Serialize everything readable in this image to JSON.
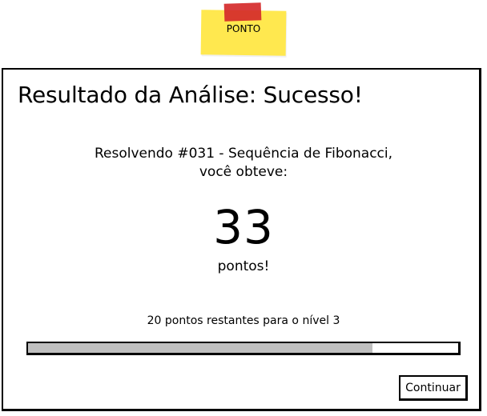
{
  "sticky_note": {
    "label": "PONTO",
    "color": "#ffe84f",
    "tape_color": "#d52a2a"
  },
  "dialog": {
    "title": "Resultado da Análise: Sucesso!",
    "description_line1": "Resolvendo #031 - Sequência de Fibonacci,",
    "description_line2": "você obteve:",
    "score": "33",
    "score_unit": "pontos!",
    "remaining_text": "20 pontos restantes para o nível 3",
    "progress_fraction": 0.8,
    "progress_fill_color": "#bfbfbf",
    "continue_label": "Continuar"
  }
}
